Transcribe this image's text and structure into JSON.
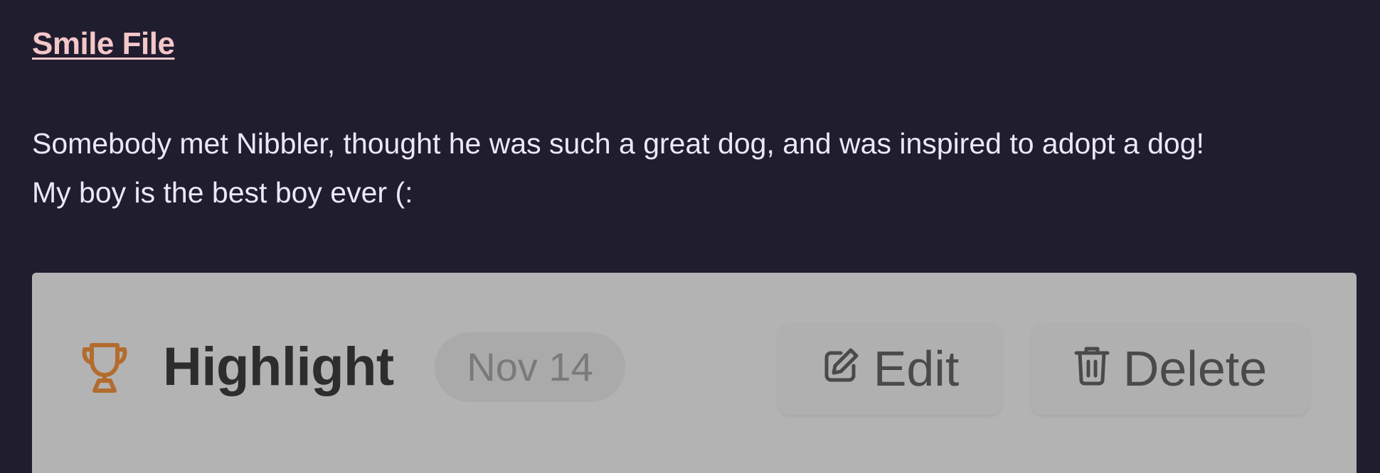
{
  "post": {
    "title": "Smile File",
    "lines": [
      "Somebody met Nibbler, thought he was such a great dog, and was inspired to adopt a dog!",
      "My boy is the best boy ever (:"
    ]
  },
  "card": {
    "icon": "trophy-icon",
    "title": "Highlight",
    "date": "Nov 14",
    "edit_label": "Edit",
    "edit_icon": "edit-icon",
    "delete_label": "Delete",
    "delete_icon": "trash-icon"
  },
  "colors": {
    "background": "#201d2f",
    "link": "#f4c7c9",
    "text": "#ece8f7",
    "card_background": "#b3b3b3",
    "trophy": "#b36c2e"
  }
}
